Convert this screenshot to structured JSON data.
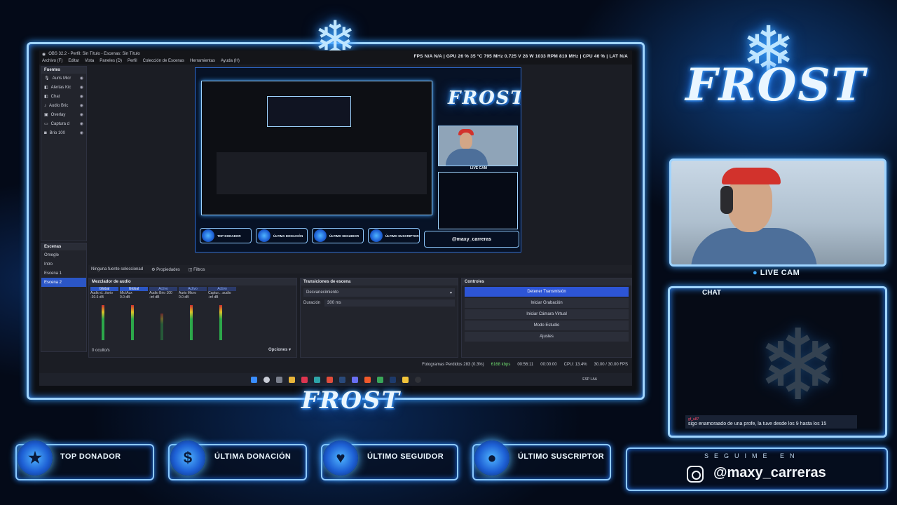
{
  "obs": {
    "title": "OBS 32.2 - Perfil: Sin Título - Escenas: Sin Título",
    "menu": [
      "Archivo (F)",
      "Editar",
      "Vista",
      "Paneles (D)",
      "Perfil",
      "Colección de Escenas",
      "Herramientas",
      "Ayuda (H)"
    ],
    "stats": "FPS N/A N/A  |  GPU 26 % 35 °C 795 MHz 0.725 V 28 W 1033 RPM 810 MHz  |  CPU 46 %  |  LAT N/A",
    "sources_header": "Fuentes",
    "sources": [
      "Auris Micr",
      "Alertas Kic",
      "Chat",
      "Audio Bric",
      "Overlay",
      "Captura d",
      "Brio 100"
    ],
    "scenes_header": "Escenas",
    "scenes": [
      "Omegle",
      "Intro",
      "Escena 1",
      "Escena 2"
    ],
    "selected_scene": "Escena 2",
    "no_source": "Ninguna fuente seleccionad",
    "properties_label": "Propiedades",
    "filters_label": "Filtros",
    "mixer_header": "Mezclador de audio",
    "mixer_channels": [
      {
        "tag": "Global",
        "name": "Audio d...itorio",
        "db": "-30.6 dB"
      },
      {
        "tag": "Global",
        "name": "Mic/Aux",
        "db": "0.0 dB"
      },
      {
        "tag": "Activo",
        "name": "Audio Brio 100",
        "db": "-inf dB"
      },
      {
        "tag": "Activo",
        "name": "Auris Micro",
        "db": "0.0 dB"
      },
      {
        "tag": "Activo",
        "name": "Captur... audio",
        "db": "-inf dB"
      }
    ],
    "hidden_count": "0 oculto/s",
    "transitions_header": "Transiciones de escena",
    "transition_value": "Desvanecimiento",
    "duration_label": "Duración",
    "duration_value": "300 ms",
    "controls_header": "Controles",
    "controls": [
      "Detener Transmisión",
      "Iniciar Grabación",
      "Iniciar Cámara Virtual",
      "Modo Estudio",
      "Ajustes"
    ],
    "options_label": "Opciones",
    "status_frames": "Fotogramas Perdidos 283 (0.3%)",
    "status_kbps": "6168 kbps",
    "status_live": "00:56:11",
    "status_rec": "00:00:00",
    "status_cpu": "CPU: 13.4%",
    "status_fps": "30.00 / 30.00 FPS",
    "tray_lang": "ESP LAA"
  },
  "overlay": {
    "logo": "FROST",
    "live_cam_label": "LIVE CAM",
    "chat_label": "CHAT",
    "chat_message": {
      "user": "gf_u87",
      "text": "sigo enamoraado de una profe, la tuve desde los 9 hasta los 15"
    },
    "badges": [
      "TOP DONADOR",
      "ÚLTIMA DONACIÓN",
      "ÚLTIMO SEGUIDOR",
      "ÚLTIMO SUSCRIPTOR"
    ],
    "follow_header": "SEGUIME EN",
    "handle": "@maxy_carreras"
  },
  "colors": {
    "accent": "#2d55d6",
    "frame_glow": "#3aa0ff",
    "chat_user": "#ff4d6d"
  }
}
